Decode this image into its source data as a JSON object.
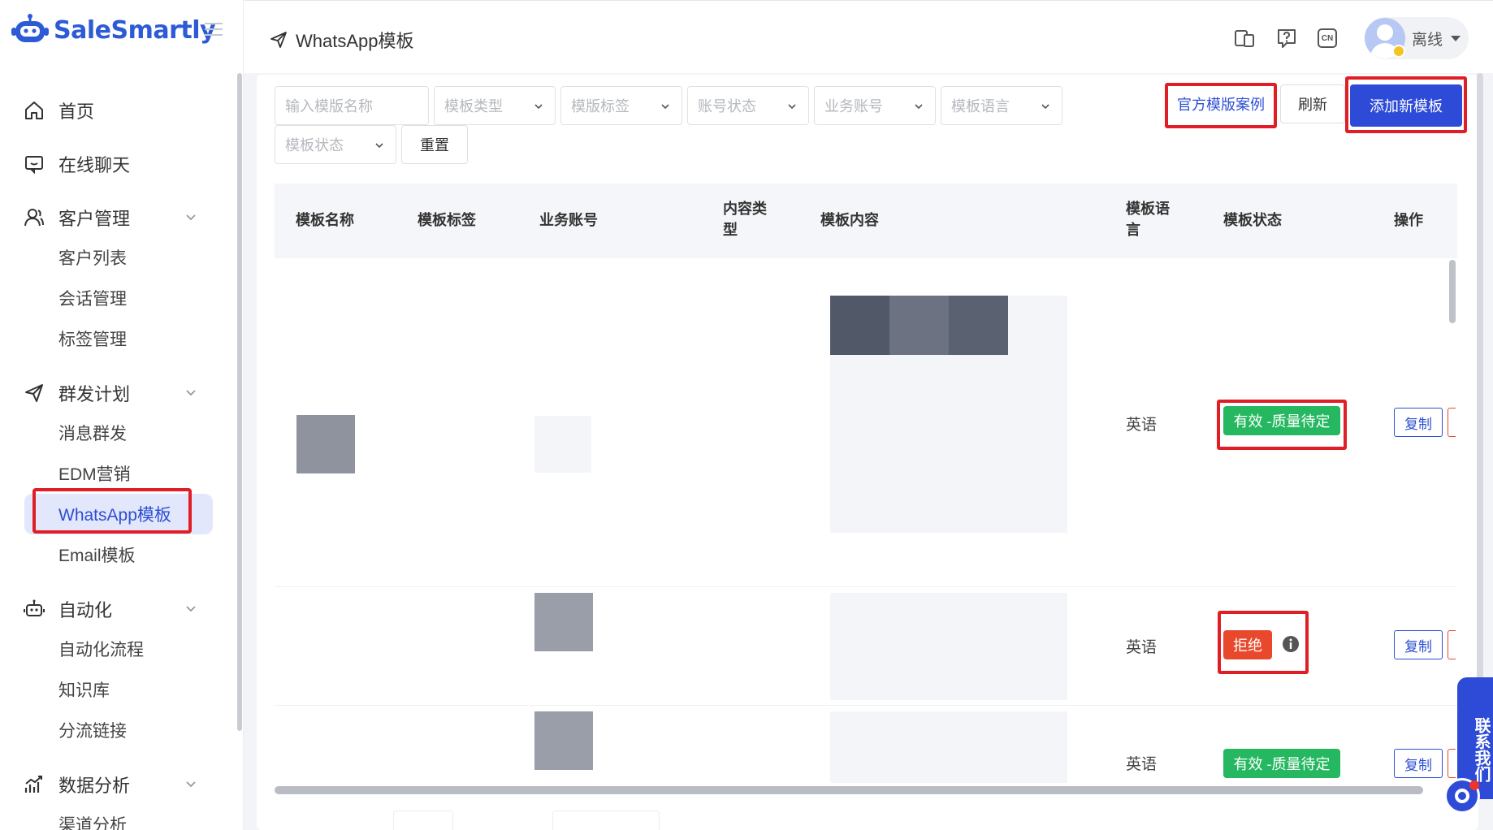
{
  "app": {
    "name": "SaleSmartly",
    "accent": "#2e4bd8",
    "highlight_red": "#e01e26"
  },
  "sidebar": {
    "items": [
      {
        "label": "首页",
        "icon": "home-icon"
      },
      {
        "label": "在线聊天",
        "icon": "chat-icon"
      },
      {
        "label": "客户管理",
        "icon": "users-icon",
        "expandable": true,
        "children": [
          "客户列表",
          "会话管理",
          "标签管理"
        ]
      },
      {
        "label": "群发计划",
        "icon": "send-icon",
        "expandable": true,
        "children": [
          "消息群发",
          "EDM营销",
          "WhatsApp模板",
          "Email模板"
        ]
      },
      {
        "label": "自动化",
        "icon": "robot-icon",
        "expandable": true,
        "children": [
          "自动化流程",
          "知识库",
          "分流链接"
        ]
      },
      {
        "label": "数据分析",
        "icon": "chart-icon",
        "expandable": true,
        "children": [
          "渠道分析"
        ]
      }
    ],
    "active_item": "WhatsApp模板"
  },
  "header": {
    "breadcrumb": "WhatsApp模板",
    "icons": [
      "devices-icon",
      "help-icon",
      "language-cn-icon"
    ],
    "language_badge": "CN",
    "user_status": "离线"
  },
  "filters": {
    "name_placeholder": "输入模版名称",
    "type": "模板类型",
    "tag": "模版标签",
    "account_status": "账号状态",
    "business_account": "业务账号",
    "language": "模板语言",
    "template_status": "模板状态",
    "reset": "重置"
  },
  "actions": {
    "official_examples": "官方模版案例",
    "refresh": "刷新",
    "add_template": "添加新模板"
  },
  "table": {
    "columns": [
      "模板名称",
      "模板标签",
      "业务账号",
      "内容类型",
      "模板内容",
      "模板语言",
      "模板状态",
      "操作"
    ],
    "columns_display": {
      "content_type_line1": "内容类",
      "content_type_line2": "型",
      "language_line1": "模板语",
      "language_line2": "言"
    },
    "rows": [
      {
        "language": "英语",
        "status": "有效 -质量待定",
        "status_color": "#25b860",
        "op": "复制",
        "highlighted": true
      },
      {
        "language": "英语",
        "status": "拒绝",
        "status_color": "#e8482b",
        "has_info": true,
        "op": "复制",
        "highlighted": true
      },
      {
        "language": "英语",
        "status": "有效 -质量待定",
        "status_color": "#25b860",
        "op": "复制",
        "highlighted": false
      }
    ]
  },
  "contact_us": "联系我们"
}
